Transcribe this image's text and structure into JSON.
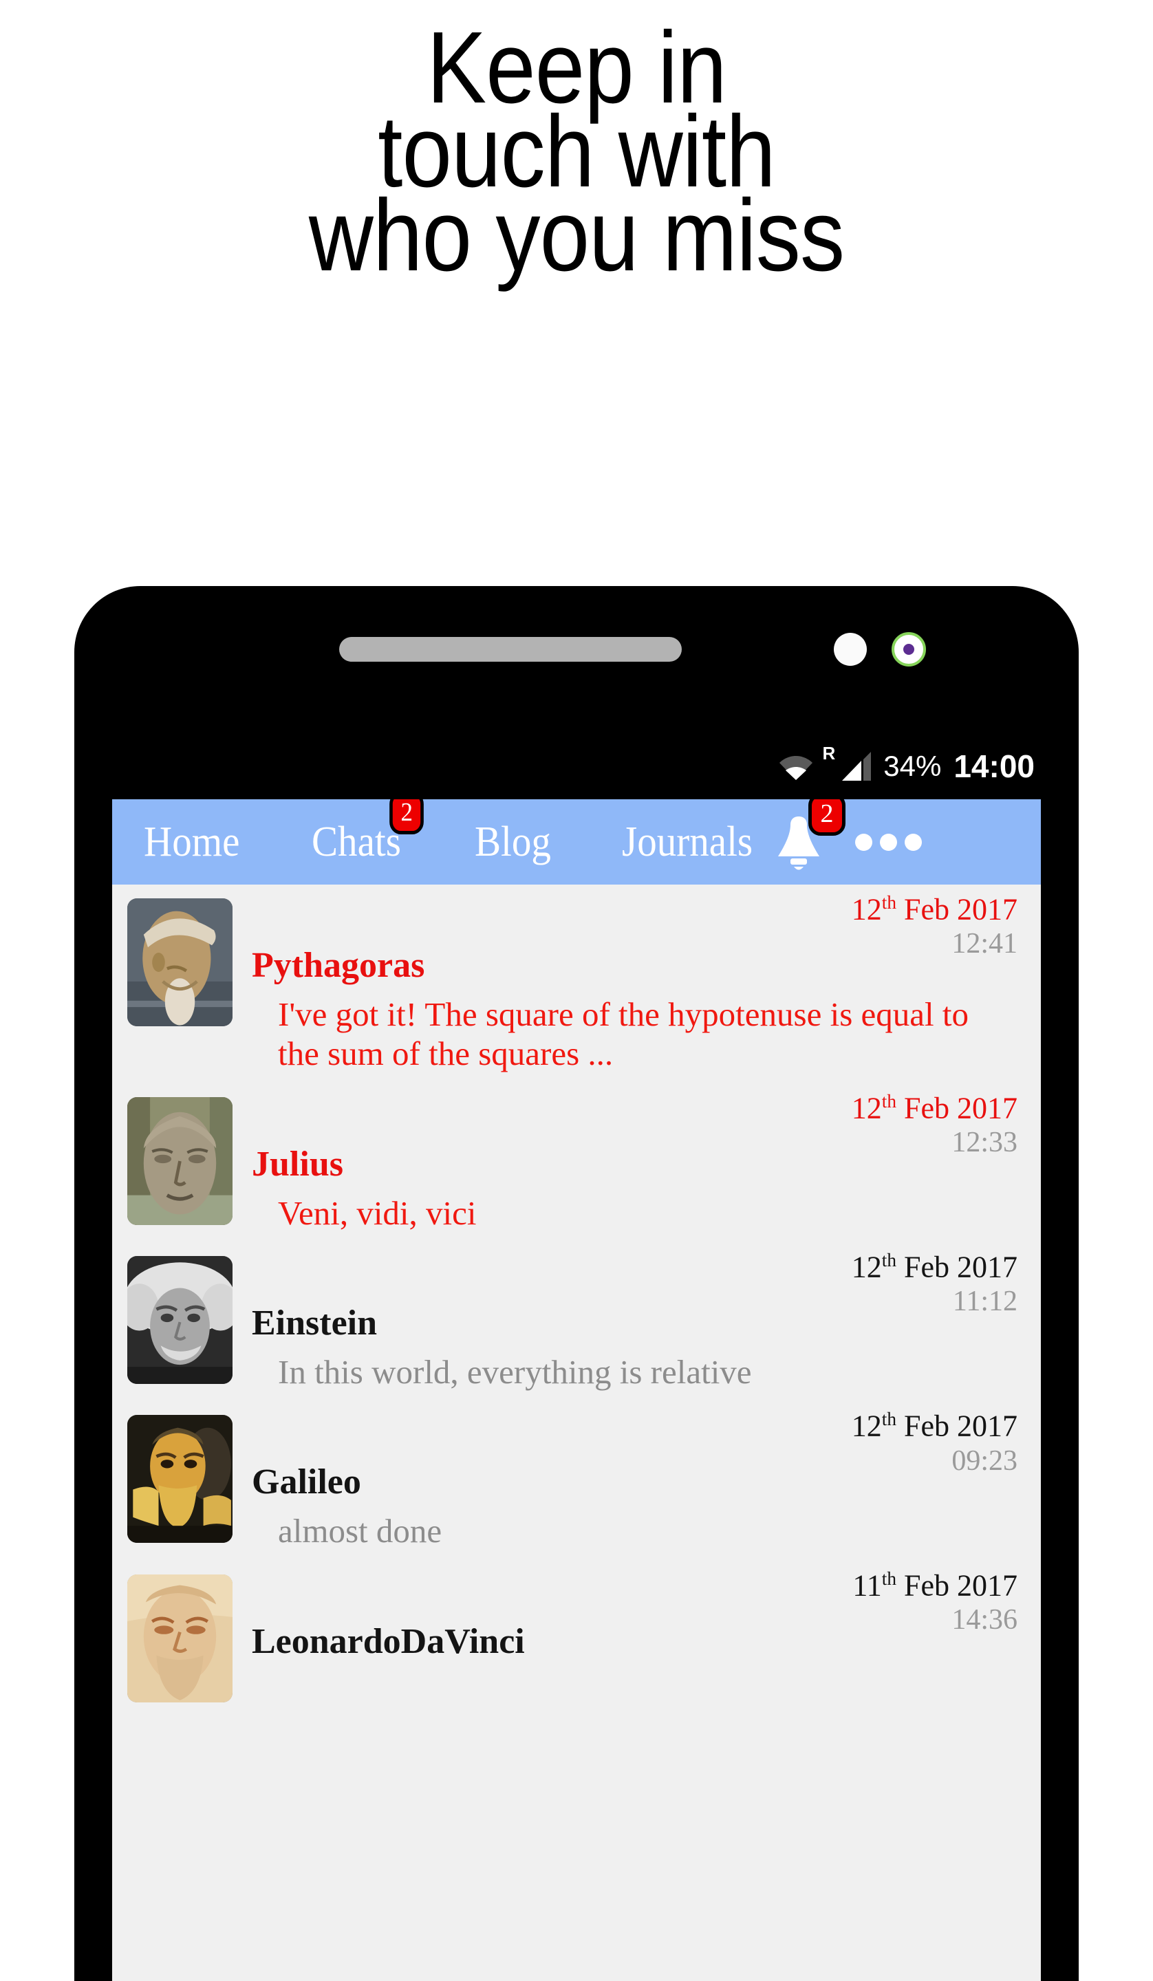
{
  "headline": {
    "lines": [
      "Keep in",
      "touch with",
      "who you miss"
    ]
  },
  "phone": {
    "bezel": {
      "speaker_label": "speaker-grille",
      "sensor_label": "proximity-sensor",
      "camera_label": "front-camera"
    },
    "statusbar": {
      "wifi_icon": "wifi-icon",
      "roaming": "R",
      "signal_icon": "signal-bars-icon",
      "battery": "34%",
      "time": "14:00"
    }
  },
  "navbar": {
    "background": "#8fb8f8",
    "items": [
      {
        "label": "Home",
        "badge": null
      },
      {
        "label": "Chats",
        "badge": "2"
      },
      {
        "label": "Blog",
        "badge": null
      },
      {
        "label": "Journals",
        "badge": null
      }
    ],
    "bell": {
      "icon": "bell-icon",
      "badge": "2"
    },
    "overflow": {
      "icon": "overflow-menu-icon"
    },
    "badge_color": "#ed0000"
  },
  "chats": [
    {
      "name": "Pythagoras",
      "message": "I've got it! The square of the hypotenuse is equal to the sum of the squares ...",
      "date_day": "12",
      "date_ord": "th",
      "date_rest": " Feb 2017",
      "time": "12:41",
      "unread": true,
      "avatar": "pythagoras-bust-avatar"
    },
    {
      "name": "Julius",
      "message": "Veni, vidi, vici",
      "date_day": "12",
      "date_ord": "th",
      "date_rest": " Feb 2017",
      "time": "12:33",
      "unread": true,
      "avatar": "julius-caesar-bust-avatar"
    },
    {
      "name": "Einstein",
      "message": "In this world, everything is relative",
      "date_day": "12",
      "date_ord": "th",
      "date_rest": " Feb 2017",
      "time": "11:12",
      "unread": false,
      "avatar": "einstein-photo-avatar"
    },
    {
      "name": "Galileo",
      "message": "almost done",
      "date_day": "12",
      "date_ord": "th",
      "date_rest": " Feb 2017",
      "time": "09:23",
      "unread": false,
      "avatar": "galileo-painting-avatar"
    },
    {
      "name": "LeonardoDaVinci",
      "message": "",
      "date_day": "11",
      "date_ord": "th",
      "date_rest": " Feb 2017",
      "time": "14:36",
      "unread": false,
      "avatar": "davinci-drawing-avatar"
    }
  ],
  "colors": {
    "unread_text": "#e8100f",
    "read_text": "#141414",
    "muted_text": "#8c8c8c",
    "screen_bg": "#f0f0f0",
    "phone_frame": "#000000"
  }
}
